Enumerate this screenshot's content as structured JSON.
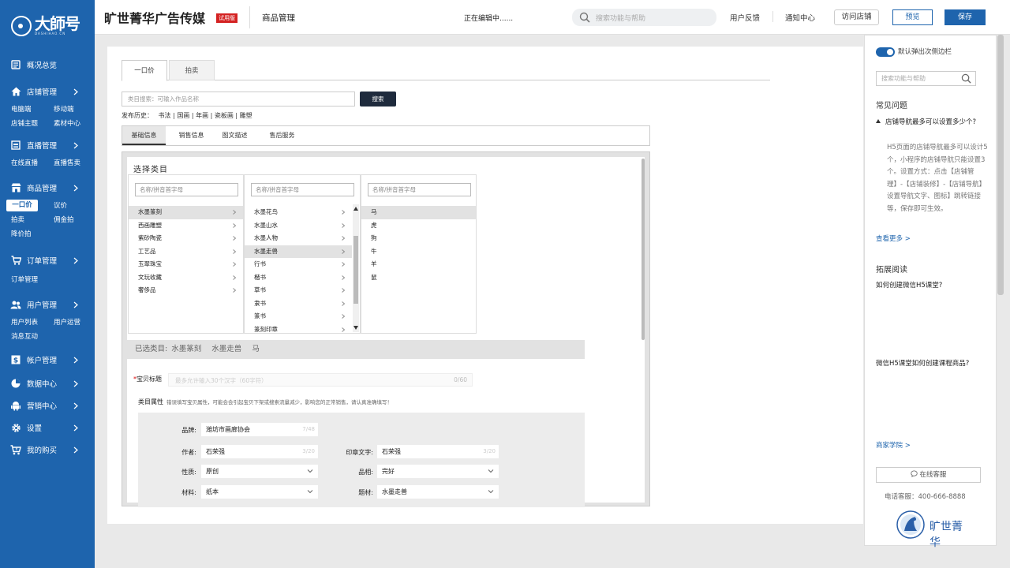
{
  "app": {
    "logo_main": "大師号",
    "logo_sub": "DASHIHAO.CN",
    "brand": "旷世菁华广告传媒",
    "trial_badge": "试用版",
    "module": "商品管理",
    "editing_status": "正在编辑中......",
    "search_placeholder": "搜索功能与帮助",
    "links": {
      "feedback": "用户反馈",
      "notices": "通知中心",
      "visit": "访问店铺"
    },
    "preview_label": "预览",
    "save_label": "保存"
  },
  "sidebar": {
    "overview": "概况总览",
    "shop": {
      "label": "店铺管理",
      "subs": [
        "电脑端",
        "移动端",
        "店铺主题",
        "素材中心"
      ]
    },
    "live": {
      "label": "直播管理",
      "subs": [
        "在线直播",
        "直播售卖"
      ]
    },
    "goods": {
      "label": "商品管理",
      "subs": [
        "一口价",
        "议价",
        "拍卖",
        "佣金拍",
        "降价拍"
      ]
    },
    "orders": {
      "label": "订单管理",
      "subs": [
        "订单管理"
      ]
    },
    "users": {
      "label": "用户管理",
      "subs": [
        "用户列表",
        "用户运营",
        "消息互动"
      ]
    },
    "account": "帐户管理",
    "data": "数据中心",
    "marketing": "营销中心",
    "settings": "设置",
    "purchases": "我的购买"
  },
  "main": {
    "tabs": [
      "一口价",
      "拍卖"
    ],
    "category_search_placeholder": "类目搜索：可输入作品名称",
    "search_button": "搜索",
    "history_label": "发布历史：",
    "history_items": [
      "书法",
      "国画",
      "年画",
      "瓷板画",
      "雕塑"
    ],
    "subtabs": [
      "基础信息",
      "销售信息",
      "图文描述",
      "售后服务"
    ],
    "select_category_title": "选择类目",
    "column_search_placeholder": "名称/拼音首字母",
    "col1": [
      "水墨篆刻",
      "西画雕塑",
      "紫砂陶瓷",
      "工艺品",
      "玉翠珠宝",
      "文玩收藏",
      "奢侈品"
    ],
    "col2": [
      "水墨花鸟",
      "水墨山水",
      "水墨人物",
      "水墨走兽",
      "行书",
      "楷书",
      "草书",
      "隶书",
      "篆书",
      "篆刻印章"
    ],
    "col3": [
      "马",
      "虎",
      "狗",
      "牛",
      "羊",
      "鼠"
    ],
    "selected_label": "已选类目:",
    "selected_path": [
      "水墨篆刻",
      "水墨走兽",
      "马"
    ],
    "title_label": "宝贝标题",
    "title_placeholder": "最多允许输入30个汉字（60字符）",
    "title_count": "0/60",
    "attr_label": "类目属性",
    "attr_hint": "错误填写宝贝属性，可能会会引起宝贝下架或搜索流量减少，影响您的正常销售，请认真准确填写！",
    "fields": {
      "brand": {
        "label": "品牌:",
        "value": "潍坊市画廊协会",
        "count": "7/48"
      },
      "author": {
        "label": "作者:",
        "value": "石荣强",
        "count": "3/20"
      },
      "seal": {
        "label": "印章文字:",
        "value": "石荣强",
        "count": "3/20"
      },
      "nature": {
        "label": "性质:",
        "value": "原创"
      },
      "condition": {
        "label": "品相:",
        "value": "完好"
      },
      "material": {
        "label": "材料:",
        "value": "纸本"
      },
      "subject": {
        "label": "题材:",
        "value": "水墨走兽"
      }
    }
  },
  "help": {
    "toggle_label": "默认弹出次侧边栏",
    "search_placeholder": "搜索功能与帮助",
    "faq_title": "常见问题",
    "faq_question": "店铺导航最多可以设置多少个?",
    "faq_answer": "H5页面的店铺导航最多可以设计5个，小程序的店铺导航只能设置3个。设置方式：点击【店铺管理】-【店铺装修】-【店铺导航】设置导航文字、图标】跳转链接等，保存即可生效。",
    "more_link": "查看更多 >",
    "ext_title": "拓展阅读",
    "ext_items": [
      "如何创建微信H5课堂?",
      "微信H5课堂如何创建课程商品?"
    ],
    "academy_link": "商家学院 >",
    "cs_button": "在线客服",
    "phone": "电话客服：400-666-8888",
    "bottom_logo_text": "旷世菁华"
  }
}
